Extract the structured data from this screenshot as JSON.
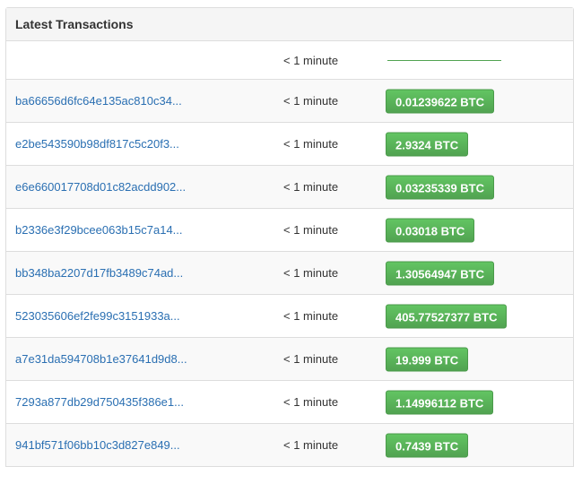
{
  "panel": {
    "title": "Latest Transactions"
  },
  "first_row": {
    "time": "< 1 minute"
  },
  "transactions": [
    {
      "hash": "ba66656d6fc64e135ac810c34...",
      "time": "< 1 minute",
      "amount": "0.01239622 BTC"
    },
    {
      "hash": "e2be543590b98df817c5c20f3...",
      "time": "< 1 minute",
      "amount": "2.9324 BTC"
    },
    {
      "hash": "e6e660017708d01c82acdd902...",
      "time": "< 1 minute",
      "amount": "0.03235339 BTC"
    },
    {
      "hash": "b2336e3f29bcee063b15c7a14...",
      "time": "< 1 minute",
      "amount": "0.03018 BTC"
    },
    {
      "hash": "bb348ba2207d17fb3489c74ad...",
      "time": "< 1 minute",
      "amount": "1.30564947 BTC"
    },
    {
      "hash": "523035606ef2fe99c3151933a...",
      "time": "< 1 minute",
      "amount": "405.77527377 BTC"
    },
    {
      "hash": "a7e31da594708b1e37641d9d8...",
      "time": "< 1 minute",
      "amount": "19.999 BTC"
    },
    {
      "hash": "7293a877db29d750435f386e1...",
      "time": "< 1 minute",
      "amount": "1.14996112 BTC"
    },
    {
      "hash": "941bf571f06bb10c3d827e849...",
      "time": "< 1 minute",
      "amount": "0.7439 BTC"
    }
  ],
  "colors": {
    "link": "#2a6fb2",
    "badge_green": "#5cb85c"
  }
}
